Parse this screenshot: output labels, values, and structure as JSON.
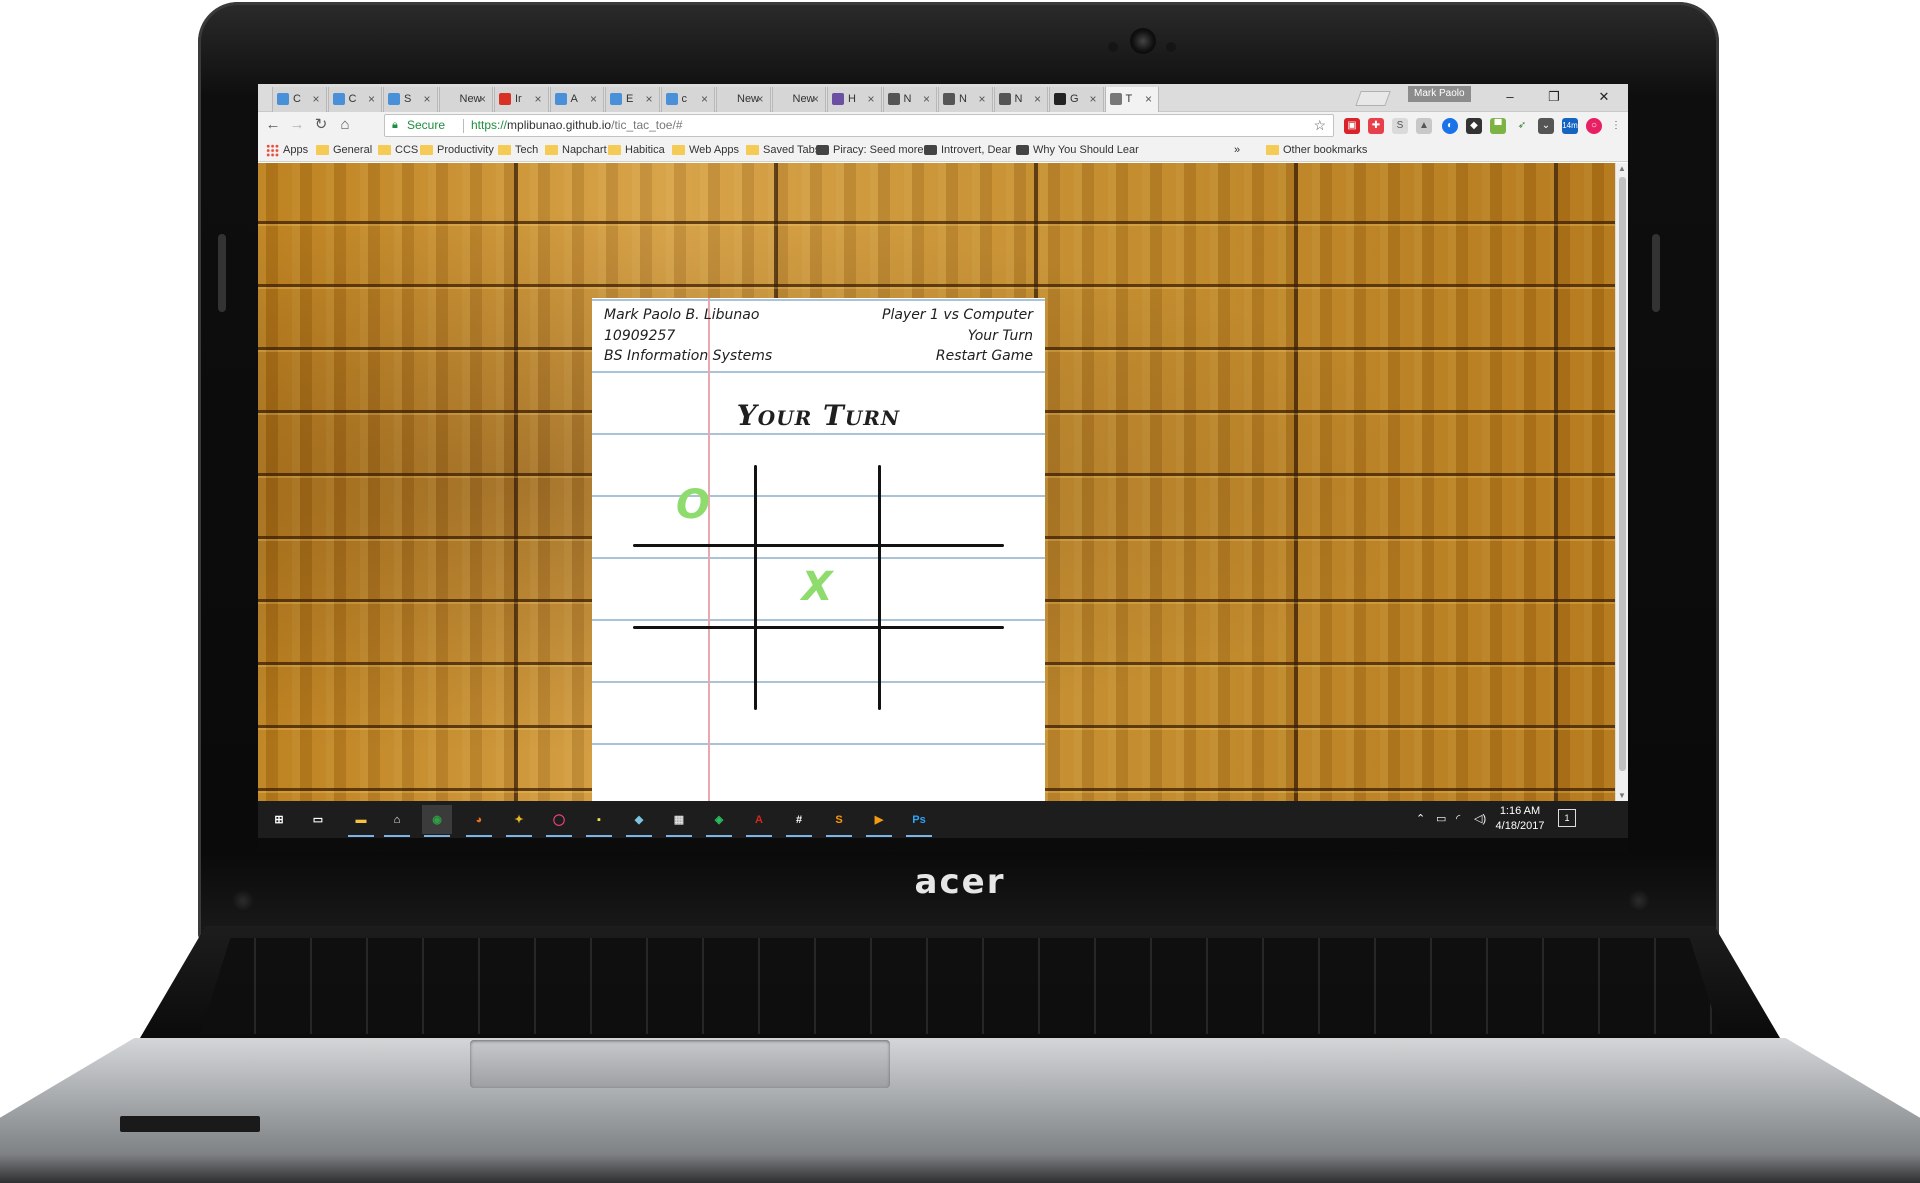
{
  "laptop": {
    "brand": "acer"
  },
  "browser": {
    "profile_name": "Mark Paolo",
    "tabs": [
      {
        "label": "C",
        "icon": "chat-icon",
        "color": "#4a90d9",
        "active": false
      },
      {
        "label": "C",
        "icon": "chat-icon",
        "color": "#4a90d9",
        "active": false
      },
      {
        "label": "S",
        "icon": "chat-icon",
        "color": "#4a90d9",
        "active": false
      },
      {
        "label": "New",
        "icon": "",
        "color": "",
        "active": false
      },
      {
        "label": "Ir",
        "icon": "gmail-icon",
        "color": "#d93025",
        "active": false
      },
      {
        "label": "A",
        "icon": "chat-icon",
        "color": "#4a90d9",
        "active": false
      },
      {
        "label": "E",
        "icon": "chat-icon",
        "color": "#4a90d9",
        "active": false
      },
      {
        "label": "c",
        "icon": "chat-icon",
        "color": "#4a90d9",
        "active": false
      },
      {
        "label": "New",
        "icon": "",
        "color": "",
        "active": false
      },
      {
        "label": "New",
        "icon": "",
        "color": "",
        "active": false
      },
      {
        "label": "H",
        "icon": "hummingbird-icon",
        "color": "#6a4fa3",
        "active": false
      },
      {
        "label": "N",
        "icon": "code-icon",
        "color": "#555555",
        "active": false
      },
      {
        "label": "N",
        "icon": "code-icon",
        "color": "#555555",
        "active": false
      },
      {
        "label": "N",
        "icon": "code-icon",
        "color": "#555555",
        "active": false
      },
      {
        "label": "G",
        "icon": "github-icon",
        "color": "#222222",
        "active": false
      },
      {
        "label": "T",
        "icon": "hash-icon",
        "color": "#777777",
        "active": true
      }
    ],
    "toolbar": {
      "secure_label": "Secure",
      "url_protocol": "https://",
      "url_host": "mplibunao.github.io",
      "url_path": "/tic_tac_toe/#",
      "badge_count": "14m"
    },
    "bookmarks": [
      {
        "label": "Apps",
        "kind": "apps"
      },
      {
        "label": "General",
        "kind": "folder"
      },
      {
        "label": "CCS",
        "kind": "folder"
      },
      {
        "label": "Productivity",
        "kind": "folder"
      },
      {
        "label": "Tech",
        "kind": "folder"
      },
      {
        "label": "Napchart",
        "kind": "folder"
      },
      {
        "label": "Habitica",
        "kind": "folder"
      },
      {
        "label": "Web Apps",
        "kind": "folder"
      },
      {
        "label": "Saved Tabs",
        "kind": "folder"
      },
      {
        "label": "Piracy: Seed more",
        "kind": "site"
      },
      {
        "label": "Introvert, Dear",
        "kind": "site"
      },
      {
        "label": "Why You Should Lear",
        "kind": "site"
      },
      {
        "label": "»",
        "kind": "more"
      },
      {
        "label": "Other bookmarks",
        "kind": "folder"
      }
    ]
  },
  "game": {
    "student_name": "Mark Paolo B. Libunao",
    "student_id": "10909257",
    "program": "BS Information Systems",
    "mode": "Player 1 vs Computer",
    "turn_label": "Your Turn",
    "restart_label": "Restart Game",
    "status": "Your Turn",
    "board": [
      [
        "O",
        "",
        ""
      ],
      [
        "",
        "X",
        ""
      ],
      [
        "",
        "",
        ""
      ]
    ],
    "mark_color": "#8fdc6e"
  },
  "taskbar": {
    "time": "1:16 AM",
    "date": "4/18/2017",
    "notification_count": "1",
    "apps": [
      {
        "name": "start-icon",
        "color": "#ffffff",
        "glyph": "⊞"
      },
      {
        "name": "task-view-icon",
        "color": "#ffffff",
        "glyph": "▭"
      },
      {
        "name": "file-explorer-icon",
        "color": "#f5c242",
        "glyph": "▬"
      },
      {
        "name": "store-icon",
        "color": "#ffffff",
        "glyph": "⌂"
      },
      {
        "name": "chrome-icon",
        "color": "#2f9e44",
        "glyph": "◉"
      },
      {
        "name": "firefox-icon",
        "color": "#e8701a",
        "glyph": "◕"
      },
      {
        "name": "puzzle-app-icon",
        "color": "#e8b923",
        "glyph": "✦"
      },
      {
        "name": "record-app-icon",
        "color": "#e9457b",
        "glyph": "◯"
      },
      {
        "name": "sticky-notes-icon",
        "color": "#f5e24d",
        "glyph": "▪"
      },
      {
        "name": "notes-app-icon",
        "color": "#7ec4e0",
        "glyph": "◆"
      },
      {
        "name": "calculator-icon",
        "color": "#dddddd",
        "glyph": "▦"
      },
      {
        "name": "evernote-icon",
        "color": "#2dbe60",
        "glyph": "◈"
      },
      {
        "name": "acrobat-icon",
        "color": "#d7261e",
        "glyph": "A"
      },
      {
        "name": "slack-icon",
        "color": "#ffffff",
        "glyph": "#"
      },
      {
        "name": "sublime-icon",
        "color": "#ff9800",
        "glyph": "S"
      },
      {
        "name": "media-player-icon",
        "color": "#f39c12",
        "glyph": "▶"
      },
      {
        "name": "photoshop-icon",
        "color": "#2fa3f7",
        "glyph": "Ps"
      }
    ]
  }
}
